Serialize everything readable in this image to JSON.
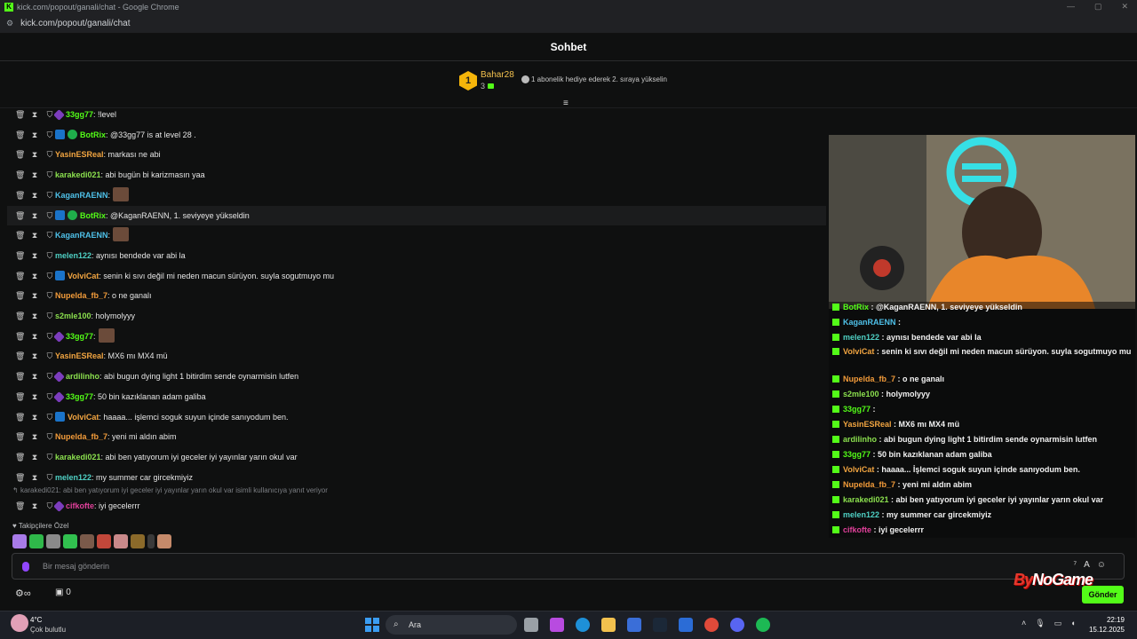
{
  "browser": {
    "title": "kick.com/popout/ganali/chat - Google Chrome",
    "url": "kick.com/popout/ganali/chat"
  },
  "header": {
    "title": "Sohbet"
  },
  "pinned": {
    "rank": "1",
    "user": "Bahar28",
    "count": "3",
    "message": "1 abonelik hediye ederek 2. sıraya yükselin"
  },
  "chat": {
    "messages": [
      {
        "user": "33gg77",
        "color": "#53fc18",
        "badges": [
          "sub"
        ],
        "text": ": !level"
      },
      {
        "user": "BotRix",
        "color": "#53fc18",
        "badges": [
          "bot",
          "verified"
        ],
        "text": ": @33gg77 is at level 28 ."
      },
      {
        "user": "YasinESReal",
        "color": "#f2a541",
        "badges": [],
        "text": ": markası ne abi"
      },
      {
        "user": "karakedi021",
        "color": "#8be04e",
        "badges": [],
        "text": ": abi bugün bi karizmasın yaa"
      },
      {
        "user": "KaganRAENN",
        "color": "#4fc1e9",
        "badges": [],
        "text": ":",
        "emote": true
      },
      {
        "user": "BotRix",
        "color": "#53fc18",
        "badges": [
          "bot",
          "verified"
        ],
        "text": ": @KaganRAENN, 1. seviyeye yükseldin",
        "highlight": true
      },
      {
        "user": "KaganRAENN",
        "color": "#4fc1e9",
        "badges": [],
        "text": ":",
        "emote": true
      },
      {
        "user": "melen122",
        "color": "#4fd1c5",
        "badges": [],
        "text": ": aynısı bendede var abi la"
      },
      {
        "user": "VolviCat",
        "color": "#f2a541",
        "badges": [
          "bot"
        ],
        "text": ": senin ki sıvı değil mi neden macun sürüyon. suyla sogutmuyo mu"
      },
      {
        "user": "Nupelda_fb_7",
        "color": "#f29b3a",
        "badges": [],
        "text": ": o ne ganalı"
      },
      {
        "user": "s2mle100",
        "color": "#8be04e",
        "badges": [],
        "text": ": holymolyyy"
      },
      {
        "user": "33gg77",
        "color": "#53fc18",
        "badges": [
          "sub"
        ],
        "text": ":",
        "emote": true
      },
      {
        "user": "YasinESReal",
        "color": "#f2a541",
        "badges": [],
        "text": ": MX6 mı MX4 mü"
      },
      {
        "user": "ardilinho",
        "color": "#8be04e",
        "badges": [
          "sub"
        ],
        "text": ": abi bugun dying light 1 bitirdim sende oynarmisin lutfen"
      },
      {
        "user": "33gg77",
        "color": "#53fc18",
        "badges": [
          "sub"
        ],
        "text": ": 50 bin kazıklanan adam galiba"
      },
      {
        "user": "VolviCat",
        "color": "#f2a541",
        "badges": [
          "bot"
        ],
        "text": ": haaaa... işlemci soguk suyun içinde sanıyodum ben."
      },
      {
        "user": "Nupelda_fb_7",
        "color": "#f29b3a",
        "badges": [],
        "text": ": yeni mi aldın abim"
      },
      {
        "user": "karakedi021",
        "color": "#8be04e",
        "badges": [],
        "text": ": abi ben yatıyorum iyi geceler iyi yayınlar yarın okul var"
      },
      {
        "user": "melen122",
        "color": "#4fd1c5",
        "badges": [],
        "text": ": my summer car gircekmiyiz"
      }
    ],
    "reply_context": "karakedi021: abi ben yatıyorum iyi geceler iyi yayınlar yarın okul var isimli kullanıcıya yanıt veriyor",
    "last_message": {
      "user": "cifkofte",
      "color": "#e0409a",
      "text": ": iyi gecelerrr"
    }
  },
  "emote_bar": {
    "label": "Takipçilere Özel"
  },
  "input": {
    "placeholder": "Bir mesaj gönderin",
    "send": "Gönder",
    "bits": "0"
  },
  "overlay": {
    "logo_prefix": "By",
    "logo_suffix": "NoGame",
    "lines": [
      {
        "user": "BotRix",
        "text": " : @KaganRAENN, 1. seviyeye yükseldin",
        "color": "#53fc18"
      },
      {
        "user": "KaganRAENN",
        "text": " : ",
        "color": "#4fc1e9"
      },
      {
        "user": "melen122",
        "text": " : aynısı bendede var abi la",
        "color": "#4fd1c5"
      },
      {
        "user": "VolviCat",
        "text": " : senin ki sıvı değil mi neden macun sürüyon. suyla sogutmuyo mu",
        "color": "#f2a541"
      },
      {
        "user": "Nupelda_fb_7",
        "text": " : o ne ganalı",
        "color": "#f29b3a"
      },
      {
        "user": "s2mle100",
        "text": " : holymolyyy",
        "color": "#8be04e"
      },
      {
        "user": "33gg77",
        "text": " : ",
        "color": "#53fc18"
      },
      {
        "user": "YasinESReal",
        "text": " : MX6 mı MX4 mü",
        "color": "#f2a541"
      },
      {
        "user": "ardilinho",
        "text": " : abi bugun dying light 1 bitirdim sende oynarmisin lutfen",
        "color": "#8be04e"
      },
      {
        "user": "33gg77",
        "text": " : 50 bin kazıklanan adam galiba",
        "color": "#53fc18"
      },
      {
        "user": "VolviCat",
        "text": " : haaaa... İşlemci soguk suyun içinde sanıyodum ben.",
        "color": "#f2a541"
      },
      {
        "user": "Nupelda_fb_7",
        "text": " : yeni mi aldın abim",
        "color": "#f29b3a"
      },
      {
        "user": "karakedi021",
        "text": " : abi ben yatıyorum iyi geceler iyi yayınlar yarın okul var",
        "color": "#8be04e"
      },
      {
        "user": "melen122",
        "text": " : my summer car gircekmiyiz",
        "color": "#4fd1c5"
      },
      {
        "user": "cifkofte",
        "text": " : iyi gecelerrr",
        "color": "#e0409a"
      }
    ]
  },
  "taskbar": {
    "weather_temp": "4°C",
    "weather_desc": "Çok bulutlu",
    "search": "Ara",
    "time": "22:19",
    "date": "15.12.2025"
  }
}
